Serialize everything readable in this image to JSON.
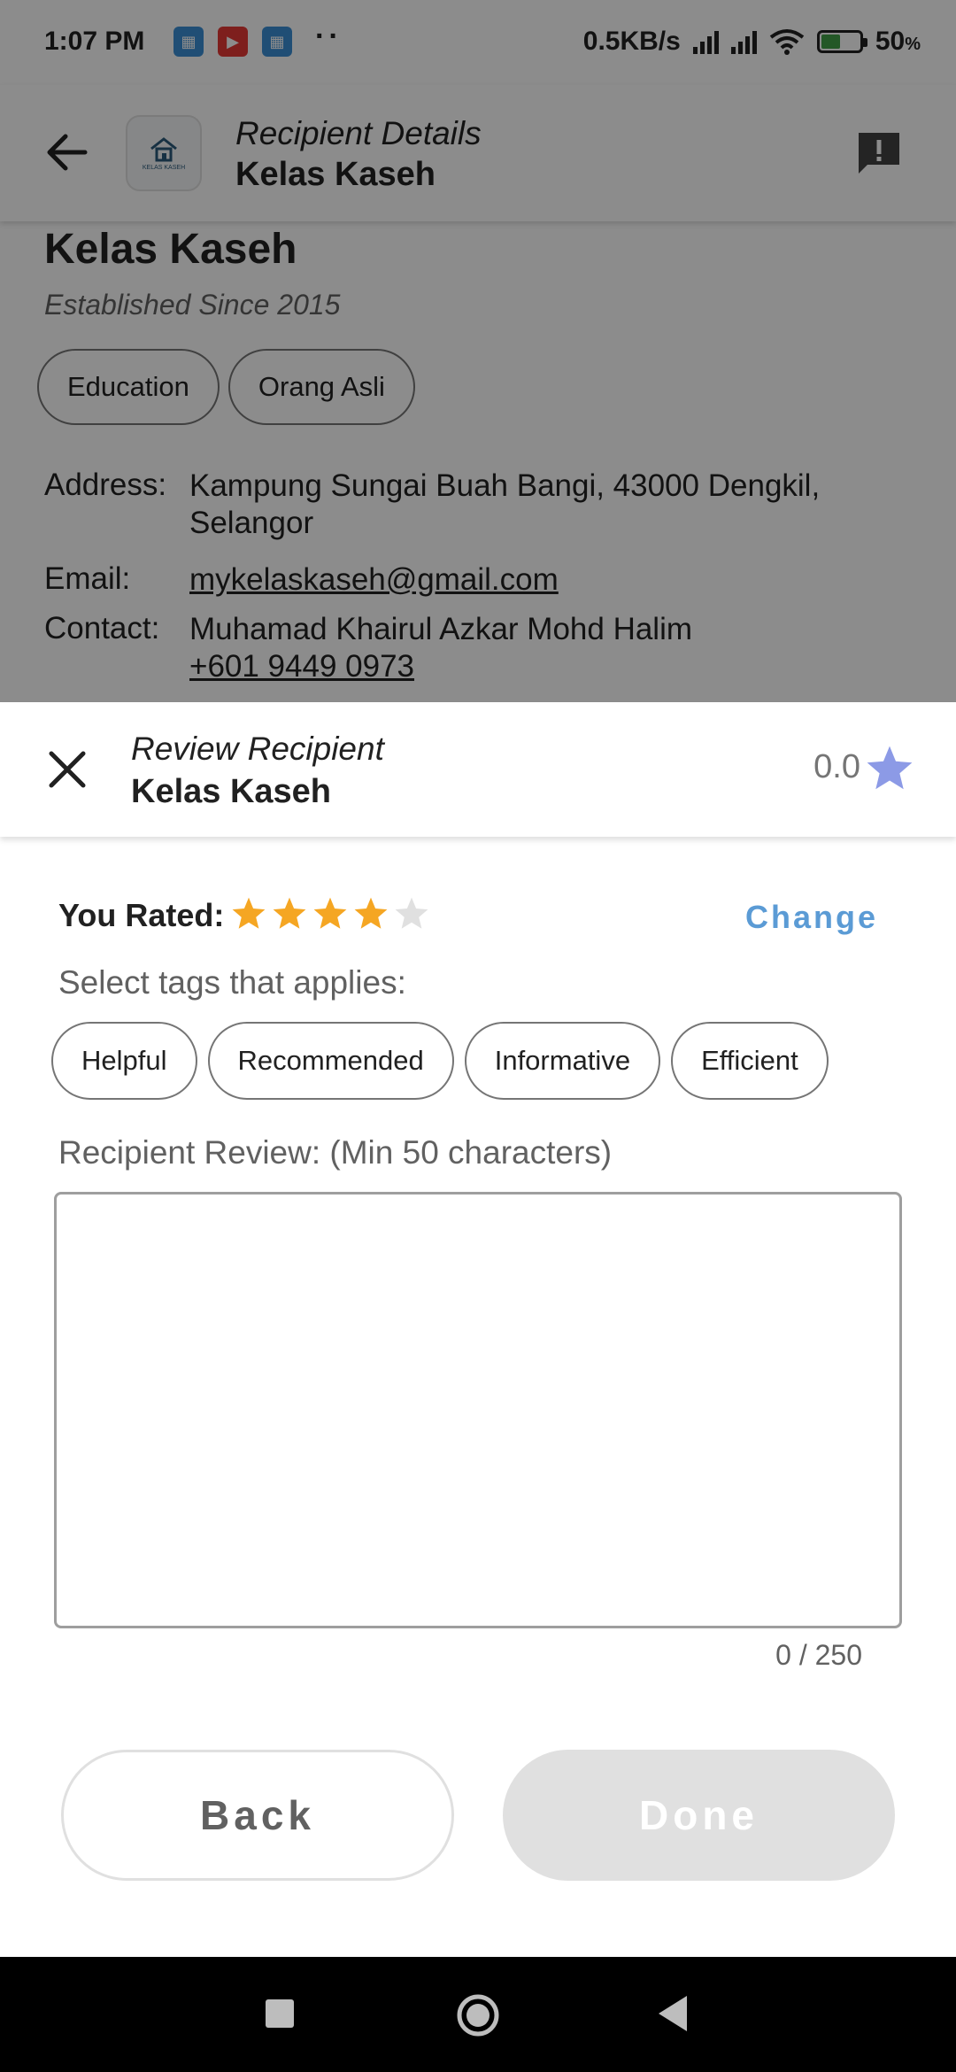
{
  "status_bar": {
    "time": "1:07 PM",
    "dots": "··",
    "net_speed": "0.5KB/s",
    "battery": "50",
    "battery_unit": "%",
    "battery_level": 0.5
  },
  "app_bar": {
    "subtitle": "Recipient Details",
    "title": "Kelas Kaseh",
    "logo_text": "KELAS KASEH"
  },
  "recipient": {
    "name": "Kelas Kaseh",
    "established": "Established Since 2015",
    "tags": [
      "Education",
      "Orang Asli"
    ],
    "address_label": "Address:",
    "address": "Kampung Sungai Buah Bangi, 43000 Dengkil, Selangor",
    "email_label": "Email:",
    "email": "mykelaskaseh@gmail.com",
    "contact_label": "Contact:",
    "contact_name": "Muhamad Khairul Azkar Mohd Halim",
    "contact_phone": "+601 9449 0973"
  },
  "review_sheet": {
    "subtitle": "Review Recipient",
    "title": "Kelas Kaseh",
    "current_rating": "0.0",
    "you_rated_label": "You Rated:",
    "user_rating": 4,
    "max_rating": 5,
    "change_label": "Change",
    "tags_prompt": "Select tags that applies:",
    "tag_options": [
      "Helpful",
      "Recommended",
      "Informative",
      "Efficient"
    ],
    "review_label": "Recipient Review: (Min 50 characters)",
    "review_value": "",
    "char_count": "0 / 250",
    "back_label": "Back",
    "done_label": "Done"
  },
  "colors": {
    "star_filled": "#f5a623",
    "star_empty": "#e0e0e0",
    "rating_star": "#8c9ae6",
    "change_link": "#5b9bd5"
  }
}
